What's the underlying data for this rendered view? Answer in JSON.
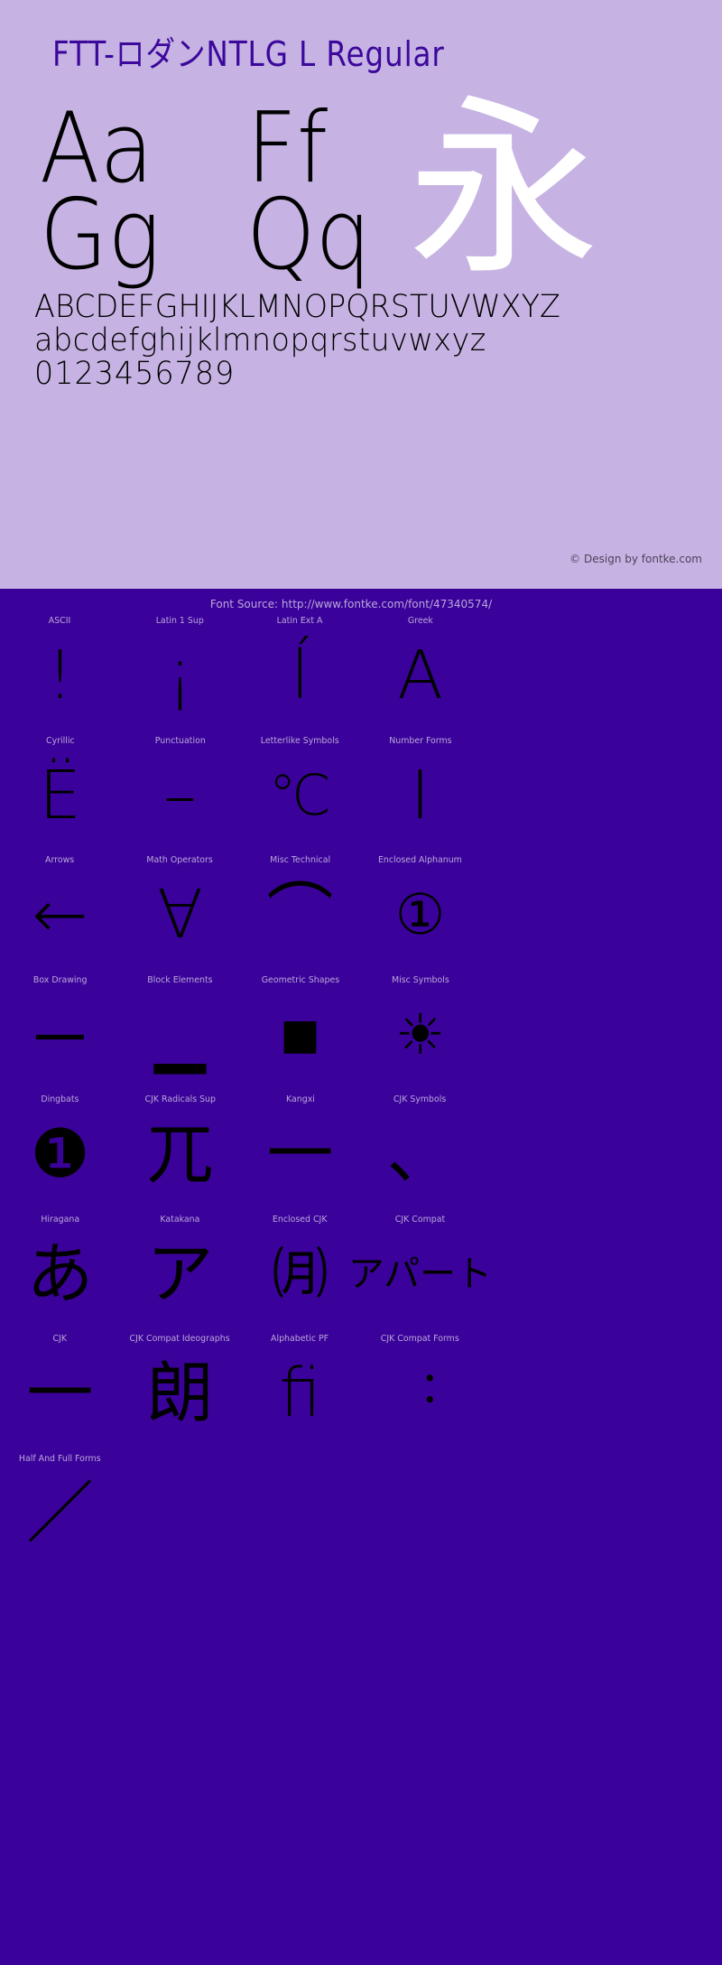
{
  "specimen": {
    "font_title": "FTT-ロダンNTLG L Regular",
    "big_samples": [
      {
        "pair1": "Aa",
        "pair2": "Ff"
      },
      {
        "pair1": "Gg",
        "pair2": "Qq"
      }
    ],
    "showcase_glyph": "永",
    "uppercase": "ABCDEFGHIJKLMNOPQRSTUVWXYZ",
    "lowercase": "abcdefghijklmnopqrstuvwxyz",
    "digits": "0123456789",
    "copyright": "© Design by fontke.com"
  },
  "blocks_panel": {
    "font_source": "Font Source: http://www.fontke.com/font/47340574/",
    "rows": [
      [
        {
          "label": "ASCII",
          "glyph": "!"
        },
        {
          "label": "Latin 1 Sup",
          "glyph": "¡"
        },
        {
          "label": "Latin Ext A",
          "glyph": "ĺ"
        },
        {
          "label": "Greek",
          "glyph": "Α"
        }
      ],
      [
        {
          "label": "Cyrillic",
          "glyph": "Ё"
        },
        {
          "label": "Punctuation",
          "glyph": "–"
        },
        {
          "label": "Letterlike Symbols",
          "glyph": "℃"
        },
        {
          "label": "Number Forms",
          "glyph": "Ⅰ"
        }
      ],
      [
        {
          "label": "Arrows",
          "glyph": "←"
        },
        {
          "label": "Math Operators",
          "glyph": "∀"
        },
        {
          "label": "Misc Technical",
          "glyph": "⌒"
        },
        {
          "label": "Enclosed Alphanum",
          "glyph": "①"
        }
      ],
      [
        {
          "label": "Box Drawing",
          "glyph": "─"
        },
        {
          "label": "Block Elements",
          "glyph": "▁"
        },
        {
          "label": "Geometric Shapes",
          "glyph": "■"
        },
        {
          "label": "Misc Symbols",
          "glyph": "☀"
        }
      ],
      [
        {
          "label": "Dingbats",
          "glyph": "❶"
        },
        {
          "label": "CJK Radicals Sup",
          "glyph": "兀"
        },
        {
          "label": "Kangxi",
          "glyph": "一"
        },
        {
          "label": "CJK Symbols",
          "glyph": "、"
        }
      ],
      [
        {
          "label": "Hiragana",
          "glyph": "あ"
        },
        {
          "label": "Katakana",
          "glyph": "ア"
        },
        {
          "label": "Enclosed CJK",
          "glyph": "㈪"
        },
        {
          "label": "CJK Compat",
          "glyph": "アパート"
        }
      ],
      [
        {
          "label": "CJK",
          "glyph": "一"
        },
        {
          "label": "CJK Compat Ideographs",
          "glyph": "朗"
        },
        {
          "label": "Alphabetic PF",
          "glyph": "ﬁ"
        },
        {
          "label": "CJK Compat Forms",
          "glyph": "︓"
        }
      ],
      [
        {
          "label": "Half And Full Forms",
          "glyph": "／"
        }
      ]
    ]
  },
  "colors": {
    "light_background": "#c6b3e3",
    "dark_background": "#3b029b",
    "title_text": "#3c089c",
    "glyph_black": "#000000",
    "showcase_white": "#ffffff",
    "label_text": "#b9a8d8",
    "copyright_text": "#4c4258"
  }
}
